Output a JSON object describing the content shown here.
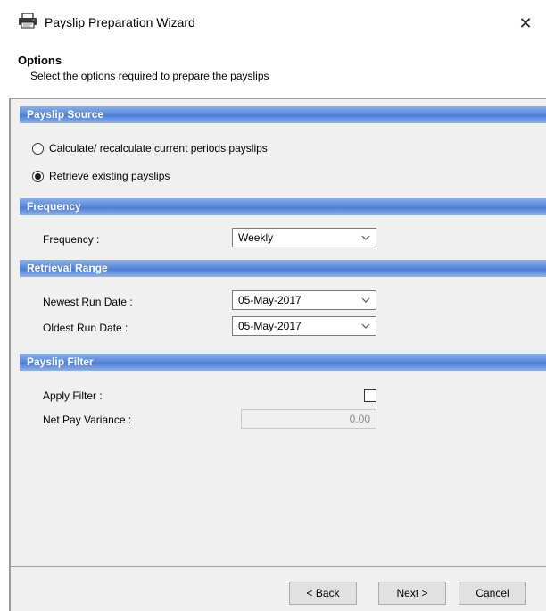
{
  "window": {
    "title": "Payslip Preparation Wizard",
    "close_symbol": "✕"
  },
  "header": {
    "title": "Options",
    "subtitle": "Select the options required to prepare the payslips"
  },
  "sections": {
    "payslip_source": {
      "heading": "Payslip Source",
      "options": [
        {
          "label": "Calculate/ recalculate current periods payslips",
          "selected": false
        },
        {
          "label": "Retrieve existing payslips",
          "selected": true
        }
      ]
    },
    "frequency": {
      "heading": "Frequency",
      "label": "Frequency :",
      "value": "Weekly"
    },
    "retrieval_range": {
      "heading": "Retrieval Range",
      "newest_label": "Newest Run Date :",
      "newest_value": "05-May-2017",
      "oldest_label": "Oldest Run Date :",
      "oldest_value": "05-May-2017"
    },
    "payslip_filter": {
      "heading": "Payslip Filter",
      "apply_label": "Apply Filter :",
      "apply_checked": false,
      "variance_label": "Net Pay Variance :",
      "variance_value": "0.00"
    }
  },
  "footer": {
    "back_label": "< Back",
    "next_label": "Next >",
    "cancel_label": "Cancel"
  },
  "icons": {
    "title_icon": "printer-icon",
    "dropdown_arrow": "chevron-down-icon"
  },
  "colors": {
    "section_header": "#5b8bdd",
    "body_background": "#f0f0f0"
  }
}
